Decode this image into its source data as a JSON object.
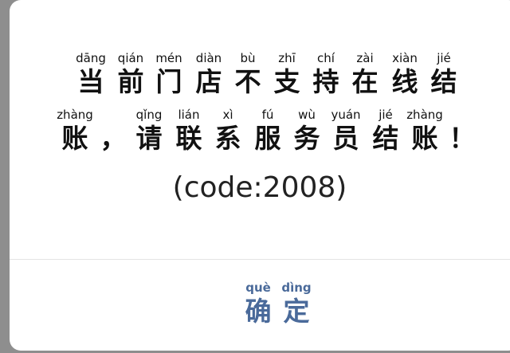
{
  "dialog": {
    "line1": [
      {
        "py": "dāng",
        "hz": "当"
      },
      {
        "py": "qián",
        "hz": "前"
      },
      {
        "py": "mén",
        "hz": "门"
      },
      {
        "py": "diàn",
        "hz": "店"
      },
      {
        "py": "bù",
        "hz": "不"
      },
      {
        "py": "zhī",
        "hz": "支"
      },
      {
        "py": "chí",
        "hz": "持"
      },
      {
        "py": "zài",
        "hz": "在"
      },
      {
        "py": "xiàn",
        "hz": "线"
      },
      {
        "py": "jié",
        "hz": "结"
      }
    ],
    "line2": [
      {
        "py": "zhàng",
        "hz": "账"
      },
      {
        "py": "",
        "hz": "，"
      },
      {
        "py": "qǐng",
        "hz": "请"
      },
      {
        "py": "lián",
        "hz": "联"
      },
      {
        "py": "xì",
        "hz": "系"
      },
      {
        "py": "fú",
        "hz": "服"
      },
      {
        "py": "wù",
        "hz": "务"
      },
      {
        "py": "yuán",
        "hz": "员"
      },
      {
        "py": "jié",
        "hz": "结"
      },
      {
        "py": "zhàng",
        "hz": "账"
      },
      {
        "py": "",
        "hz": "！"
      }
    ],
    "code": "(code:2008)",
    "confirm": [
      {
        "py": "què",
        "hz": "确"
      },
      {
        "py": "dìng",
        "hz": "定"
      }
    ],
    "colors": {
      "backdrop": "#8e8e8e",
      "dialog_bg": "#ffffff",
      "text": "#111111",
      "button_text": "#4a6a9a",
      "divider": "#e4e4e4"
    }
  }
}
